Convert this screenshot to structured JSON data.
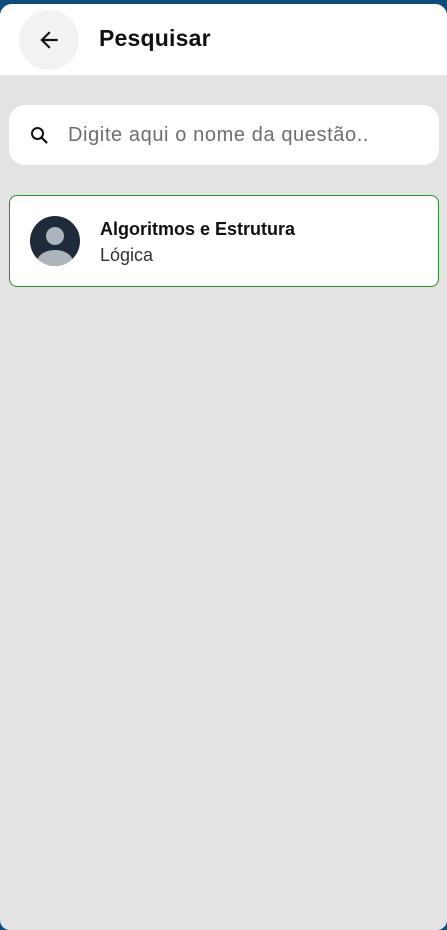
{
  "header": {
    "title": "Pesquisar",
    "back_icon": "arrow-left-icon"
  },
  "search": {
    "placeholder": "Digite aqui o nome da questão..",
    "value": "",
    "icon": "search-icon"
  },
  "results": [
    {
      "title": "Algoritmos e Estrutura",
      "subtitle": "Lógica",
      "avatar_icon": "user-avatar-icon"
    }
  ],
  "colors": {
    "top_bar": "#0f4c7c",
    "background": "#e3e3e3",
    "card_border": "#2f8a2f",
    "avatar_bg": "#1f2b3a"
  }
}
